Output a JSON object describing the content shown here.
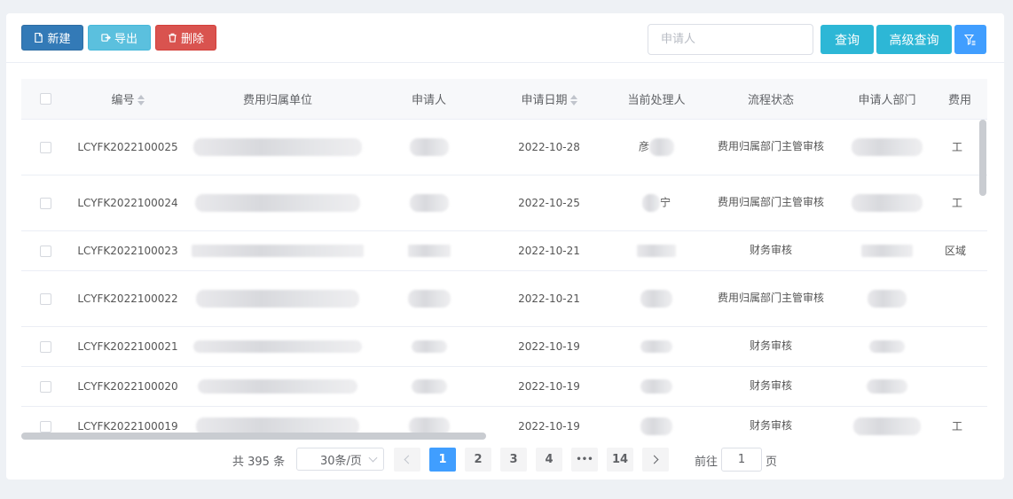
{
  "toolbar": {
    "new_label": "新建",
    "export_label": "导出",
    "delete_label": "删除",
    "search_placeholder": "申请人",
    "query_label": "查询",
    "advanced_query_label": "高级查询"
  },
  "table": {
    "columns": [
      "编号",
      "费用归属单位",
      "申请人",
      "申请日期",
      "当前处理人",
      "流程状态",
      "申请人部门",
      "费用"
    ],
    "rows": [
      {
        "id": "LCYFK2022100025",
        "date": "2022-10-28",
        "handler_partial": "彦",
        "status": "费用归属部门主管审核",
        "last_partial": "工"
      },
      {
        "id": "LCYFK2022100024",
        "date": "2022-10-25",
        "handler_partial": "宁",
        "status": "费用归属部门主管审核",
        "last_partial": "工"
      },
      {
        "id": "LCYFK2022100023",
        "date": "2022-10-21",
        "handler_partial": "",
        "status": "财务审核",
        "last_partial": "区域"
      },
      {
        "id": "LCYFK2022100022",
        "date": "2022-10-21",
        "handler_partial": "",
        "status": "费用归属部门主管审核",
        "last_partial": ""
      },
      {
        "id": "LCYFK2022100021",
        "date": "2022-10-19",
        "handler_partial": "",
        "status": "财务审核",
        "last_partial": ""
      },
      {
        "id": "LCYFK2022100020",
        "date": "2022-10-19",
        "handler_partial": "",
        "status": "财务审核",
        "last_partial": ""
      },
      {
        "id": "LCYFK2022100019",
        "date": "2022-10-19",
        "handler_partial": "",
        "status": "财务审核",
        "last_partial": "工"
      }
    ]
  },
  "pagination": {
    "total_text": "共 395 条",
    "page_size": "30条/页",
    "pages": [
      "1",
      "2",
      "3",
      "4",
      "•••",
      "14"
    ],
    "current": "1",
    "goto_label": "前往",
    "goto_value": "1",
    "page_suffix": "页"
  },
  "colors": {
    "new": "#337ab7",
    "export": "#5bc0de",
    "delete": "#d9534f",
    "query": "#2db7d6",
    "primary": "#409eff"
  }
}
